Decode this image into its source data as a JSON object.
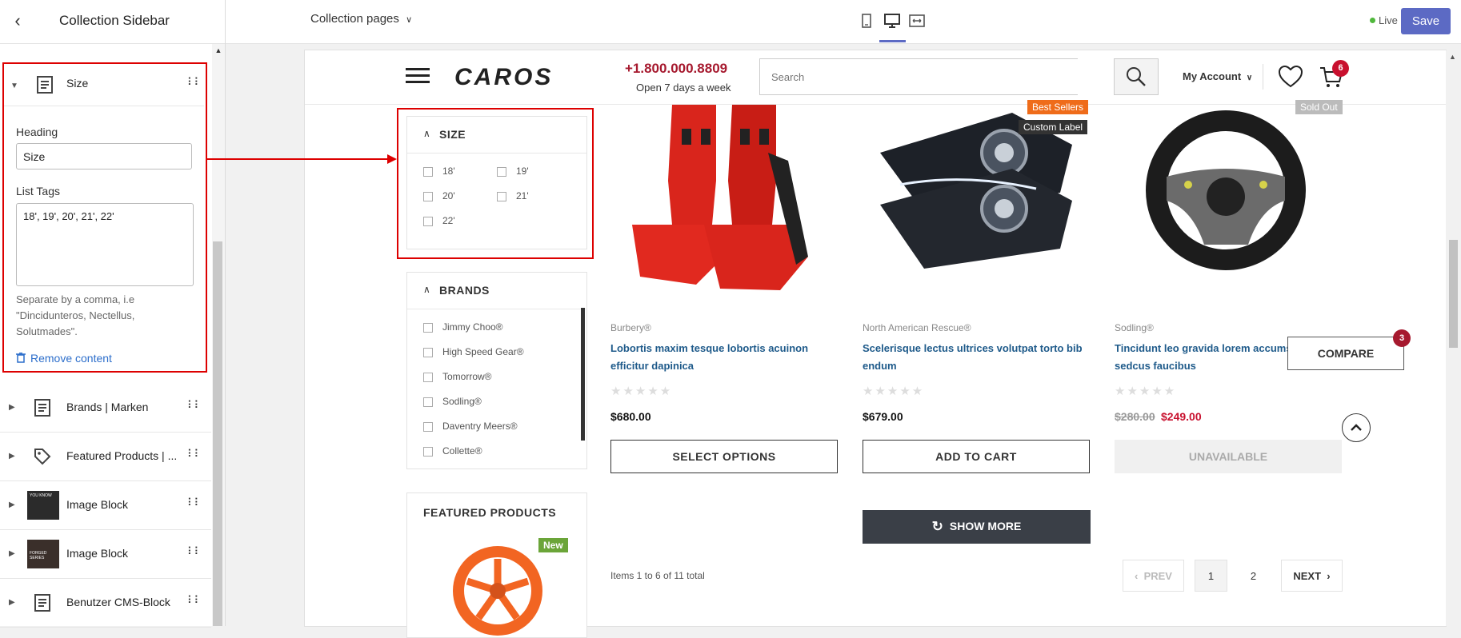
{
  "sidebar": {
    "title": "Collection Sidebar",
    "sections": [
      {
        "label": "Size"
      },
      {
        "label": "Brands | Marken"
      },
      {
        "label": "Featured Products | ..."
      },
      {
        "label": "Image Block"
      },
      {
        "label": "Image Block"
      },
      {
        "label": "Benutzer CMS-Block"
      }
    ],
    "size_editor": {
      "heading_label": "Heading",
      "heading_value": "Size",
      "list_tags_label": "List Tags",
      "list_tags_value": "18', 19', 20', 21', 22'",
      "help_text": "Separate by a comma, i.e \"Dincidunteros, Nectellus, Solutmades\".",
      "remove_label": "Remove content"
    },
    "thumb_text": {
      "img1": "YOU KNOW",
      "img2": "FORGED SERIES"
    }
  },
  "topbar": {
    "page_select": "Collection pages",
    "live": "Live",
    "save": "Save"
  },
  "store": {
    "phone": "+1.800.000.8809",
    "phone_sub": "Open 7 days a week",
    "search_placeholder": "Search",
    "my_account": "My Account",
    "cart_count": "6",
    "logo": "CAROS"
  },
  "filters": {
    "size": {
      "title": "SIZE",
      "options": [
        "18'",
        "19'",
        "20'",
        "21'",
        "22'"
      ]
    },
    "brands": {
      "title": "BRANDS",
      "options": [
        "Jimmy Choo®",
        "High Speed Gear®",
        "Tomorrow®",
        "Sodling®",
        "Daventry Meers®",
        "Collette®"
      ]
    },
    "featured": {
      "title": "FEATURED PRODUCTS",
      "badge": "New"
    }
  },
  "products": [
    {
      "vendor": "Burbery®",
      "title": "Lobortis maxim tesque lobortis acuinon efficitur dapinica",
      "price": "$680.00",
      "button": "SELECT OPTIONS"
    },
    {
      "vendor": "North American Rescue®",
      "title": "Scelerisque lectus ultrices volutpat torto bib endum",
      "price": "$679.00",
      "button": "ADD TO CART",
      "badges": [
        "Best Sellers",
        "Custom Label"
      ]
    },
    {
      "vendor": "Sodling®",
      "title": "Tincidunt leo gravida lorem accumsan sedcus faucibus",
      "price_old": "$280.00",
      "price": "$249.00",
      "button": "UNAVAILABLE",
      "badges": [
        "Sold Out"
      ]
    }
  ],
  "show_more": "SHOW MORE",
  "pagination": {
    "summary": "Items 1 to 6 of 11 total",
    "prev": "PREV",
    "pages": [
      "1",
      "2"
    ],
    "next": "NEXT"
  },
  "compare": {
    "label": "COMPARE",
    "count": "3"
  },
  "colors": {
    "accent": "#5c6ac4",
    "brand_red": "#a6192e",
    "highlight": "#dd0000",
    "link_blue": "#1e5a8a"
  }
}
